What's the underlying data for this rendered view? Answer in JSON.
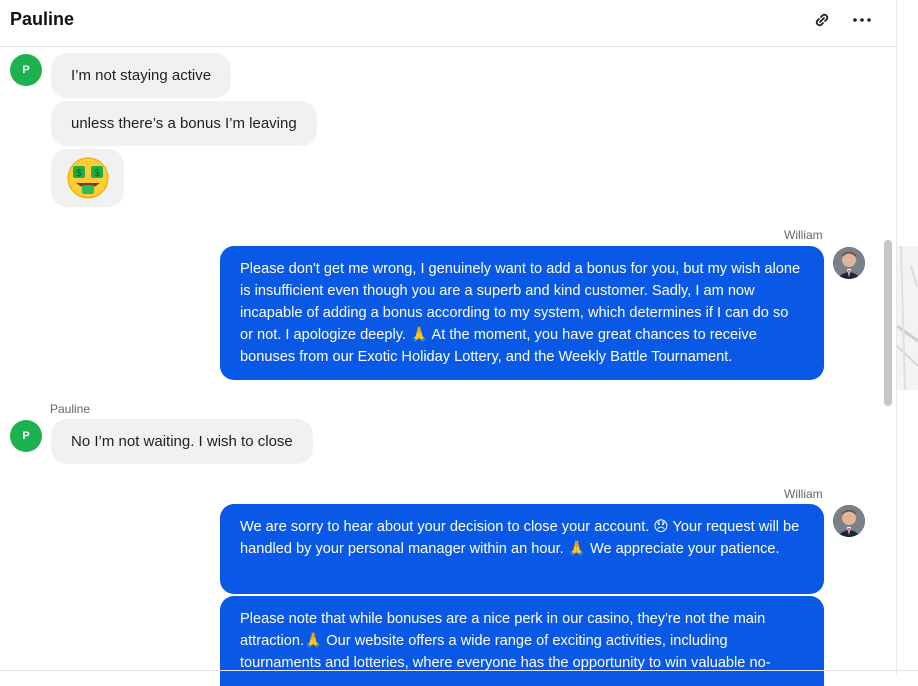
{
  "header": {
    "title": "Pauline",
    "link_icon": "link-icon",
    "more_icon": "more-horizontal-icon"
  },
  "avatars": {
    "pauline_initial": "P"
  },
  "messages": {
    "m1": "I’m not staying active",
    "m2": "unless there’s a bonus I’m leaving",
    "m3_emoji_name": "money-mouth-face-icon",
    "william_label_1": "William",
    "m4": "Please don't get me wrong, I genuinely want to add a bonus for you, but my wish alone is insufficient even though you are a superb and kind customer. Sadly, I am now incapable of adding a bonus according to my system, which determines if I can do so or not. I apologize deeply. 🙏 At the moment, you have great chances to receive bonuses from our Exotic Holiday Lottery, and the Weekly Battle Tournament.",
    "pauline_label": "Pauline",
    "m5": "No I’m not waiting. I wish to close",
    "william_label_2": "William",
    "m6": "We are sorry to hear about your decision to close your account. 😞 Your request will be handled by your personal manager within an hour. 🙏 We appreciate your patience.",
    "m7": "Please note that while bonuses are a nice perk in our casino, they're not the main attraction.🙏 Our website offers a wide range of exciting activities, including tournaments and lotteries, where everyone has the opportunity to win valuable no-"
  },
  "colors": {
    "outgoing_bubble": "#0a59e6",
    "incoming_bubble": "#f1f1f1",
    "avatar_green": "#1db150"
  }
}
